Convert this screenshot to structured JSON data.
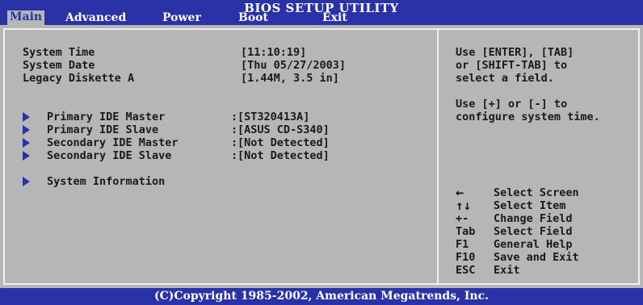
{
  "header": {
    "title": "BIOS SETUP UTILITY",
    "menu": [
      {
        "label": "Main",
        "active": true
      },
      {
        "label": "Advanced"
      },
      {
        "label": "Power"
      },
      {
        "label": "Boot"
      },
      {
        "label": "Exit"
      }
    ]
  },
  "settings": [
    {
      "label": "System Time",
      "value": "[11:10:19]"
    },
    {
      "label": "System Date",
      "value": "[Thu 05/27/2003]"
    },
    {
      "label": "Legacy Diskette A",
      "value": "[1.44M, 3.5 in]"
    }
  ],
  "submenus": [
    {
      "label": "Primary IDE Master",
      "value": "[ST320413A]"
    },
    {
      "label": "Primary IDE Slave",
      "value": "[ASUS CD-S340]"
    },
    {
      "label": "Secondary IDE Master",
      "value": "[Not Detected]"
    },
    {
      "label": "Secondary IDE Slave",
      "value": "[Not Detected]"
    },
    {
      "label": "System Information",
      "value": ""
    }
  ],
  "help": {
    "text1": "Use [ENTER], [TAB]\nor [SHIFT-TAB] to\nselect a field.",
    "text2": "Use [+] or [-] to\nconfigure system time."
  },
  "keys": [
    {
      "key": "←",
      "desc": "Select Screen"
    },
    {
      "key": "↑↓",
      "desc": "Select Item"
    },
    {
      "key": "+-",
      "desc": "Change Field"
    },
    {
      "key": "Tab",
      "desc": "Select Field"
    },
    {
      "key": "F1",
      "desc": "General Help"
    },
    {
      "key": "F10",
      "desc": "Save and Exit"
    },
    {
      "key": "ESC",
      "desc": "Exit"
    }
  ],
  "footer": "(C)Copyright 1985-2002, American Megatrends, Inc.",
  "colors": {
    "bar": "#2a32a8",
    "background": "#b6b6b6",
    "text": "#1a1a1a"
  }
}
